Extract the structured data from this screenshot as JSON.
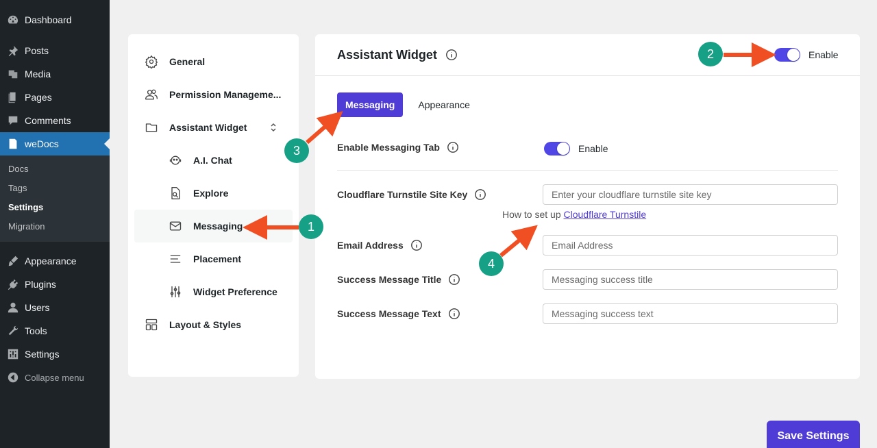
{
  "wp_menu": {
    "top_items": [
      {
        "label": "Dashboard",
        "icon": "dashboard-icon"
      },
      {
        "label": "Posts",
        "icon": "pin-icon"
      },
      {
        "label": "Media",
        "icon": "media-icon"
      },
      {
        "label": "Pages",
        "icon": "pages-icon"
      },
      {
        "label": "Comments",
        "icon": "comment-icon"
      },
      {
        "label": "weDocs",
        "icon": "docs-icon"
      }
    ],
    "sub_items": [
      "Docs",
      "Tags",
      "Settings",
      "Migration"
    ],
    "bottom_items": [
      {
        "label": "Appearance",
        "icon": "brush-icon"
      },
      {
        "label": "Plugins",
        "icon": "plug-icon"
      },
      {
        "label": "Users",
        "icon": "user-icon"
      },
      {
        "label": "Tools",
        "icon": "wrench-icon"
      },
      {
        "label": "Settings",
        "icon": "settings-icon"
      }
    ],
    "collapse_label": "Collapse menu"
  },
  "settings_nav": {
    "items": [
      {
        "label": "General",
        "icon": "gear-icon"
      },
      {
        "label": "Permission Manageme...",
        "icon": "users-icon"
      },
      {
        "label": "Assistant Widget",
        "icon": "folder-icon"
      },
      {
        "label": "A.I. Chat",
        "icon": "robot-icon"
      },
      {
        "label": "Explore",
        "icon": "explore-icon"
      },
      {
        "label": "Messaging",
        "icon": "envelope-icon"
      },
      {
        "label": "Placement",
        "icon": "lines-icon"
      },
      {
        "label": "Widget Preference",
        "icon": "sliders-icon"
      },
      {
        "label": "Layout & Styles",
        "icon": "layout-icon"
      }
    ]
  },
  "main": {
    "title": "Assistant Widget",
    "enable_label": "Enable",
    "tabs": [
      "Messaging",
      "Appearance"
    ],
    "enable_messaging_label": "Enable Messaging Tab",
    "enable_messaging_toggle_label": "Enable",
    "fields": [
      {
        "label": "Cloudflare Turnstile Site Key",
        "placeholder": "Enter your cloudflare turnstile site key"
      },
      {
        "label": "Email Address",
        "placeholder": "Email Address"
      },
      {
        "label": "Success Message Title",
        "placeholder": "Messaging success title"
      },
      {
        "label": "Success Message Text",
        "placeholder": "Messaging success text"
      }
    ],
    "howto_prefix": "How to set up ",
    "howto_link": "Cloudflare Turnstile"
  },
  "save_button": "Save Settings",
  "annotations": [
    "1",
    "2",
    "3",
    "4"
  ],
  "colors": {
    "accent": "#4f3bd6",
    "badge": "#16a085",
    "arrow": "#f04e23",
    "wp_active": "#2271b1"
  }
}
